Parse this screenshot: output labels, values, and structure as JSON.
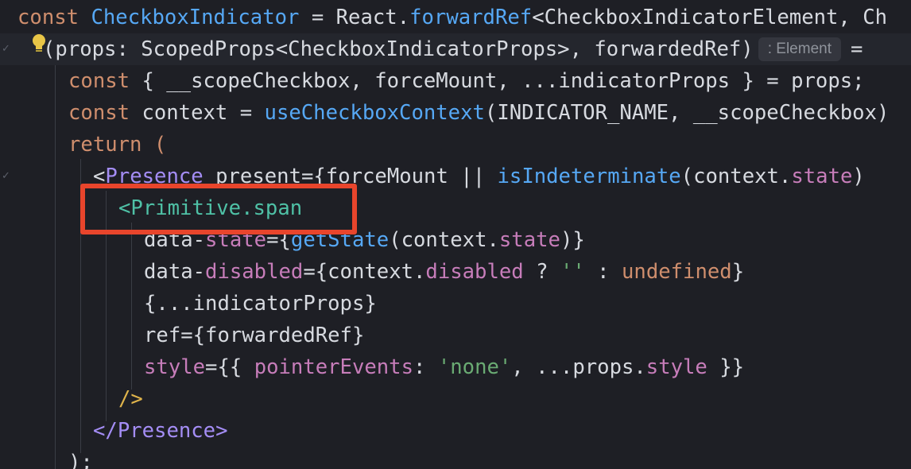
{
  "editor": {
    "inlay_hint": ": Element",
    "lines": [
      {
        "code": "const CheckboxIndicator = React.forwardRef<CheckboxIndicatorElement, Ch"
      },
      {
        "code": "(props: ScopedProps<CheckboxIndicatorProps>, forwardedRef)"
      },
      {
        "code": "const { __scopeCheckbox, forceMount, ...indicatorProps } = props;"
      },
      {
        "code": "const context = useCheckboxContext(INDICATOR_NAME, __scopeCheckbox)"
      },
      {
        "code": "return ("
      },
      {
        "code": "<Presence present={forceMount || isIndeterminate(context.state)"
      },
      {
        "code": "<Primitive.span"
      },
      {
        "code": "data-state={getState(context.state)}"
      },
      {
        "code": "data-disabled={context.disabled ? '' : undefined}"
      },
      {
        "code": "{...indicatorProps}"
      },
      {
        "code": "ref={forwardedRef}"
      },
      {
        "code": "style={{ pointerEvents: 'none', ...props.style }}"
      },
      {
        "code": "/>"
      },
      {
        "code": "</Presence>"
      },
      {
        "code": ");"
      }
    ]
  },
  "annotation": {
    "highlighted_text": "<Primitive.span",
    "color": "#e8452c"
  },
  "colors": {
    "background": "#1e1f25",
    "keyword": "#cf8e6d",
    "function": "#56a8f5",
    "tag": "#4fc1a6",
    "string": "#6aab73",
    "property": "#c77dba",
    "component": "#a48df5"
  },
  "icons": {
    "lightbulb": "lightbulb-icon",
    "fold_marker": "fold-icon"
  }
}
